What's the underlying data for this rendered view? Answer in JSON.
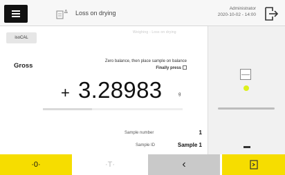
{
  "header": {
    "title": "Loss on drying",
    "user": "Administrator",
    "datetime": "2020-10-02 - 14:00",
    "task_icon": "document-delta-icon",
    "logout_icon": "logout-icon"
  },
  "main": {
    "isocal_label": "isoCAL",
    "status_faint": "Weighing - Loss on drying",
    "gross_label": "Gross",
    "instruction_line1": "Zero balance, then place sample on balance",
    "instruction_line2": "Finally press",
    "sign": "+",
    "weight": "3.28983",
    "unit": "g",
    "progress_fraction": 0.35,
    "sample_number_label": "Sample number",
    "sample_number_value": "1",
    "sample_id_label": "Sample ID",
    "sample_id_value": "Sample 1"
  },
  "bottom": {
    "zero_label": "·0·",
    "tare_label": "·T·",
    "back_label": "‹",
    "next_icon": "next-step-icon"
  },
  "colors": {
    "accent_yellow": "#f6dd00",
    "stability_green": "#ddf01c"
  }
}
